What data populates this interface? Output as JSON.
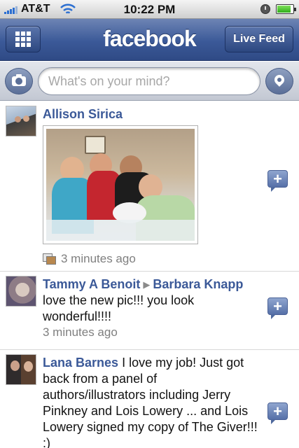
{
  "status_bar": {
    "carrier": "AT&T",
    "time": "10:22 PM",
    "icons": [
      "signal-bars-icon",
      "wifi-icon",
      "rotation-lock-icon",
      "battery-icon"
    ],
    "battery_level": 0.85
  },
  "nav_bar": {
    "logo": "facebook",
    "left_button_icon": "grid-menu-icon",
    "right_button_label": "Live Feed",
    "color": "#3b5998"
  },
  "composer": {
    "placeholder": "What's on your mind?",
    "left_icon": "camera-icon",
    "right_icon": "location-pin-icon"
  },
  "feed": {
    "items": [
      {
        "author": "Allison Sirica",
        "text": "",
        "has_photo": true,
        "timestamp": "3 minutes ago",
        "meta_icon": "photo-album-icon"
      },
      {
        "author": "Tammy A Benoit",
        "target": "Barbara Knapp",
        "text": "love the new pic!!! you look wonderful!!!!",
        "timestamp": "3 minutes ago"
      },
      {
        "author": "Lana Barnes",
        "text": "I love my job! Just got back from a panel of authors/illustrators including Jerry Pinkney and Lois Lowery ... and Lois Lowery signed my copy of The Giver!!! :)",
        "timestamp": ""
      }
    ],
    "comment_icon": "add-comment-icon",
    "link_color": "#3b5998"
  }
}
